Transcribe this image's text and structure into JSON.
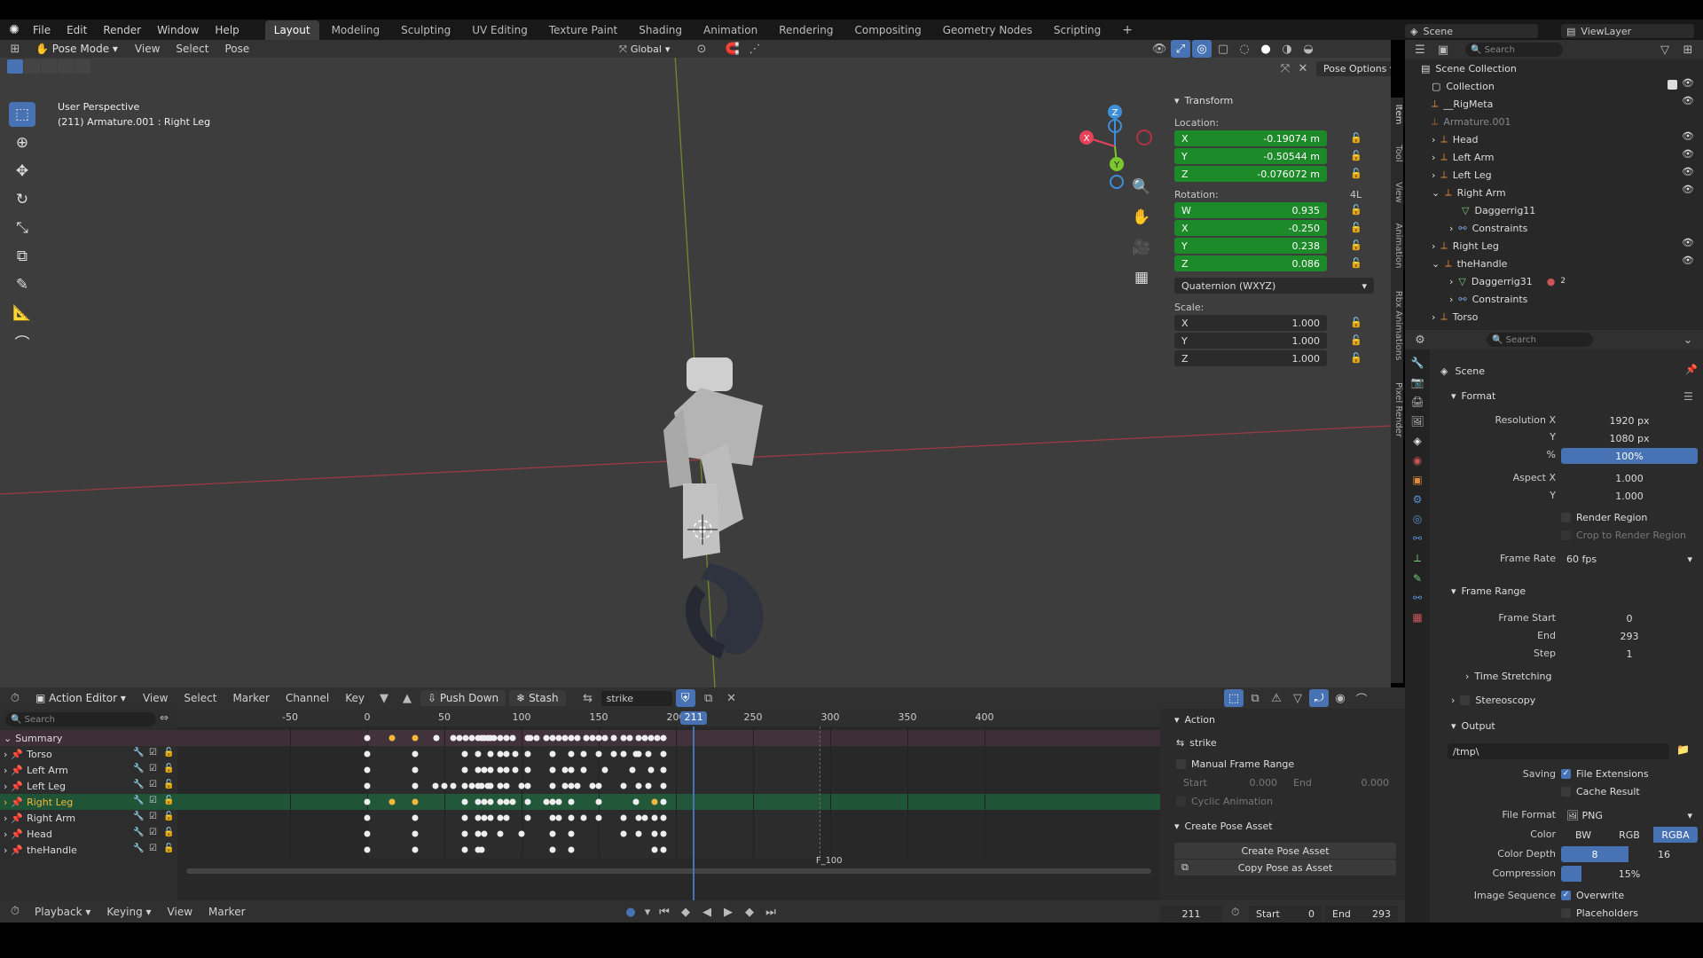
{
  "topbar": {
    "menus": [
      "File",
      "Edit",
      "Render",
      "Window",
      "Help"
    ],
    "workspaces": [
      "Layout",
      "Modeling",
      "Sculpting",
      "UV Editing",
      "Texture Paint",
      "Shading",
      "Animation",
      "Rendering",
      "Compositing",
      "Geometry Nodes",
      "Scripting"
    ],
    "active_workspace": "Layout",
    "scene": "Scene",
    "view_layer": "ViewLayer"
  },
  "viewport": {
    "mode": "Pose Mode",
    "menus": [
      "View",
      "Select",
      "Pose"
    ],
    "transform_orientation": "Global",
    "pose_options": "Pose Options",
    "overlay_line1": "User Perspective",
    "overlay_line2": "(211) Armature.001 : Right Leg",
    "gizmo": {
      "z": "Z",
      "y": "Y",
      "x": "X"
    },
    "side_tabs": [
      "Item",
      "Tool",
      "View",
      "Animation",
      "Rbx Animations",
      "Pixel Render"
    ],
    "colors": {
      "bg": "#3d3d3d",
      "x_axis": "#a13a45",
      "y_axis": "#7a9a30",
      "gizmo_x": "#e64259",
      "gizmo_y": "#7bc72d",
      "gizmo_z": "#3f8ed8"
    }
  },
  "transform": {
    "title": "Transform",
    "location_label": "Location:",
    "location": [
      {
        "axis": "X",
        "value": "-0.19074 m"
      },
      {
        "axis": "Y",
        "value": "-0.50544 m"
      },
      {
        "axis": "Z",
        "value": "-0.076072 m"
      }
    ],
    "rotation_label": "Rotation:",
    "rotation_mode_badge": "4L",
    "rotation": [
      {
        "axis": "W",
        "value": "0.935"
      },
      {
        "axis": "X",
        "value": "-0.250"
      },
      {
        "axis": "Y",
        "value": "0.238"
      },
      {
        "axis": "Z",
        "value": "0.086"
      }
    ],
    "rotation_mode": "Quaternion (WXYZ)",
    "scale_label": "Scale:",
    "scale": [
      {
        "axis": "X",
        "value": "1.000"
      },
      {
        "axis": "Y",
        "value": "1.000"
      },
      {
        "axis": "Z",
        "value": "1.000"
      }
    ]
  },
  "outliner": {
    "search_placeholder": "Search",
    "items": [
      {
        "label": "Scene Collection",
        "indent": 0
      },
      {
        "label": "Collection",
        "indent": 1
      },
      {
        "label": "__RigMeta",
        "indent": 1
      },
      {
        "label": "Armature.001",
        "indent": 1
      },
      {
        "label": "Head",
        "indent": 2
      },
      {
        "label": "Left Arm",
        "indent": 2
      },
      {
        "label": "Left Leg",
        "indent": 2
      },
      {
        "label": "Right Arm",
        "indent": 2
      },
      {
        "label": "Daggerrig11",
        "indent": 3
      },
      {
        "label": "Constraints",
        "indent": 3
      },
      {
        "label": "Right Leg",
        "indent": 2
      },
      {
        "label": "theHandle",
        "indent": 2
      },
      {
        "label": "Daggerrig31",
        "indent": 3
      },
      {
        "label": "Constraints",
        "indent": 3
      },
      {
        "label": "Torso",
        "indent": 2
      }
    ],
    "badge": "2"
  },
  "properties": {
    "search_placeholder": "Search",
    "context": "Scene",
    "format": {
      "title": "Format",
      "res_x_label": "Resolution X",
      "res_x": "1920 px",
      "res_y_label": "Y",
      "res_y": "1080 px",
      "pct_label": "%",
      "pct": "100%",
      "aspect_x_label": "Aspect X",
      "aspect_x": "1.000",
      "aspect_y_label": "Y",
      "aspect_y": "1.000",
      "render_region": "Render Region",
      "crop_region": "Crop to Render Region",
      "frame_rate_label": "Frame Rate",
      "frame_rate": "60 fps"
    },
    "frame_range": {
      "title": "Frame Range",
      "start_label": "Frame Start",
      "start": "0",
      "end_label": "End",
      "end": "293",
      "step_label": "Step",
      "step": "1",
      "time_stretching": "Time Stretching"
    },
    "stereoscopy": "Stereoscopy",
    "output": {
      "title": "Output",
      "path": "/tmp\\",
      "saving_label": "Saving",
      "file_extensions": "File Extensions",
      "cache_result": "Cache Result",
      "file_format_label": "File Format",
      "file_format": "PNG",
      "color_label": "Color",
      "color_opts": [
        "BW",
        "RGB",
        "RGBA"
      ],
      "color_active": "RGBA",
      "depth_label": "Color Depth",
      "depth_opts": [
        "8",
        "16"
      ],
      "compression_label": "Compression",
      "compression": "15%",
      "compression_fraction": 0.15,
      "seq_label": "Image Sequence",
      "overwrite": "Overwrite",
      "placeholders": "Placeholders"
    }
  },
  "action_editor": {
    "editor": "Action Editor",
    "menus": [
      "View",
      "Select",
      "Marker",
      "Channel",
      "Key"
    ],
    "push_down": "Push Down",
    "stash": "Stash",
    "action_name": "strike",
    "search_placeholder": "Search",
    "ruler": [
      "-50",
      "0",
      "50",
      "100",
      "150",
      "200",
      "250",
      "300",
      "350",
      "400"
    ],
    "current_frame": "211",
    "marker": "F_100",
    "channels": [
      "Summary",
      "Torso",
      "Left Arm",
      "Left Leg",
      "Right Leg",
      "Right Arm",
      "Head",
      "theHandle"
    ],
    "active_channel": "Right Leg",
    "keyframes": {
      "Summary": [
        0,
        16,
        31,
        45,
        56,
        60,
        64,
        68,
        72,
        74,
        76,
        78,
        80,
        82,
        86,
        90,
        94,
        104,
        106,
        110,
        116,
        120,
        124,
        128,
        132,
        136,
        142,
        146,
        150,
        154,
        160,
        166,
        170,
        176,
        180,
        184,
        188,
        192
      ],
      "Torso": [
        0,
        31,
        63,
        72,
        80,
        86,
        90,
        96,
        104,
        120,
        132,
        140,
        150,
        160,
        166,
        174,
        176,
        182,
        192
      ],
      "Left Arm": [
        0,
        31,
        63,
        72,
        76,
        80,
        86,
        90,
        96,
        104,
        120,
        128,
        132,
        140,
        154,
        172,
        184,
        192
      ],
      "Left Leg": [
        0,
        31,
        44,
        50,
        56,
        63,
        68,
        72,
        74,
        78,
        80,
        86,
        90,
        100,
        104,
        120,
        128,
        132,
        136,
        146,
        150,
        166,
        176,
        182,
        192
      ],
      "Right Leg": [
        0,
        16,
        31,
        63,
        72,
        76,
        80,
        86,
        90,
        94,
        104,
        116,
        120,
        124,
        132,
        150,
        174,
        186,
        192
      ],
      "Right Arm": [
        0,
        31,
        63,
        72,
        76,
        80,
        86,
        90,
        104,
        120,
        124,
        132,
        140,
        150,
        166,
        176,
        180,
        186,
        192
      ],
      "Head": [
        0,
        31,
        63,
        72,
        76,
        86,
        100,
        120,
        132,
        166,
        176,
        186,
        192
      ],
      "theHandle": [
        0,
        31,
        63,
        72,
        74,
        120,
        132,
        186,
        192
      ]
    },
    "selected_keys": {
      "Summary": [
        16,
        31,
        186
      ],
      "Right Leg": [
        16,
        31,
        186
      ]
    }
  },
  "action_panel": {
    "action_title": "Action",
    "action_name": "strike",
    "manual_range": "Manual Frame Range",
    "start_label": "Start",
    "start": "0.000",
    "end_label": "End",
    "end": "0.000",
    "cyclic": "Cyclic Animation",
    "pose_asset_title": "Create Pose Asset",
    "create_pose_asset": "Create Pose Asset",
    "copy_pose_asset": "Copy Pose as Asset"
  },
  "timeline": {
    "menus": [
      "Playback",
      "Keying",
      "View",
      "Marker"
    ],
    "current_frame": "211",
    "start_label": "Start",
    "start": "0",
    "end_label": "End",
    "end": "293"
  }
}
